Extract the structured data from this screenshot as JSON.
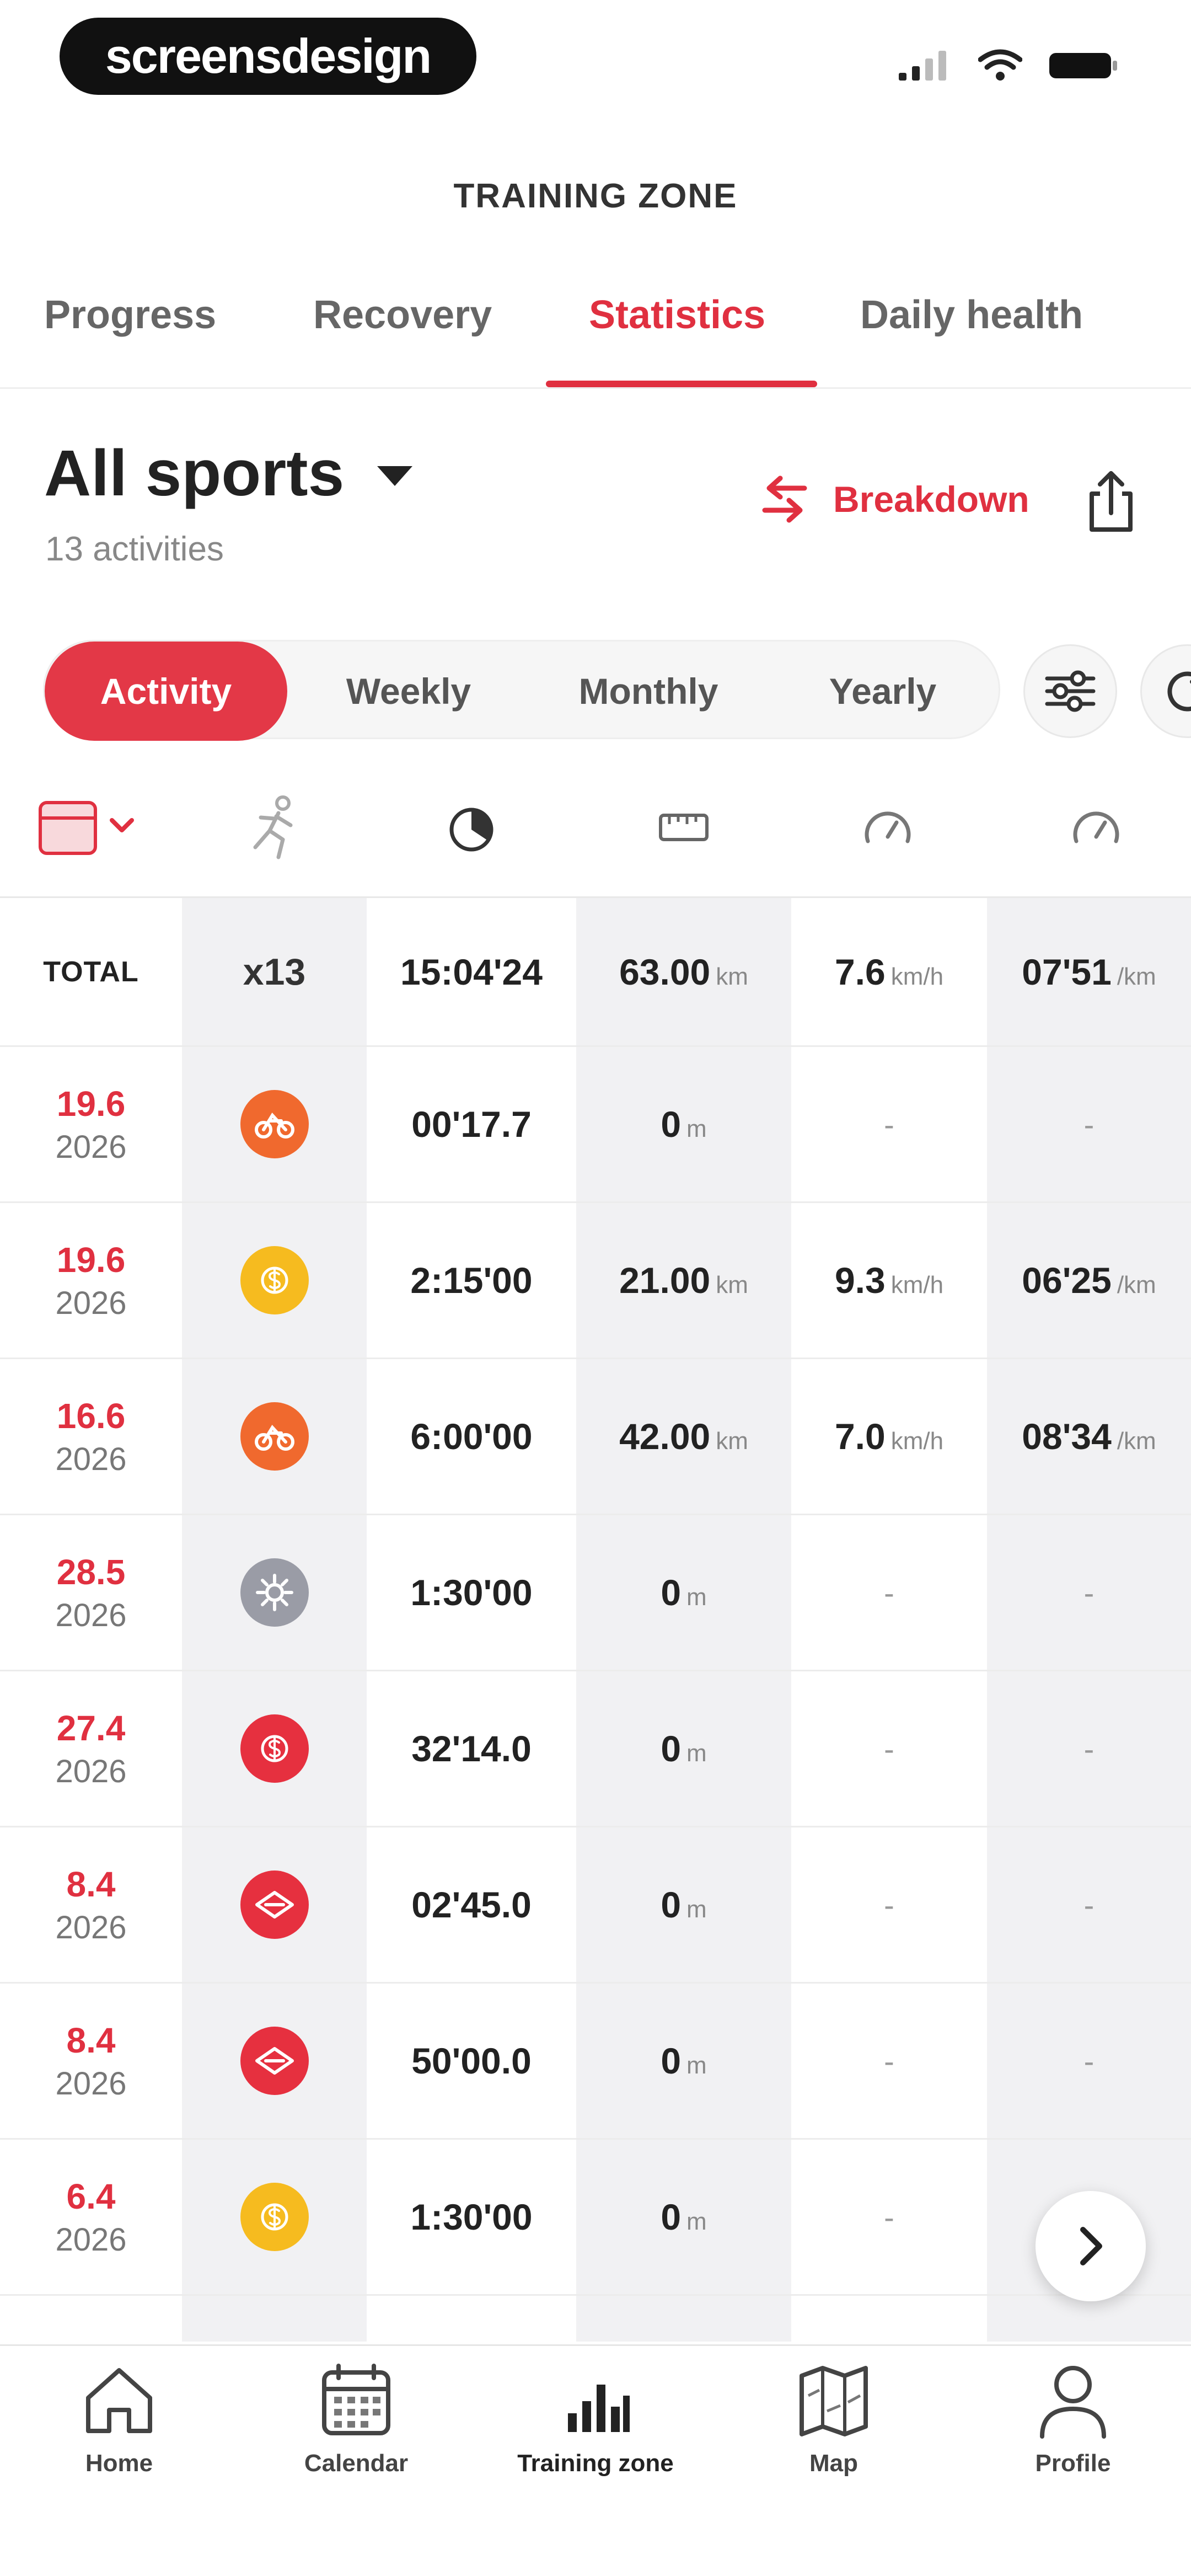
{
  "status_bar": {
    "brand": "screensdesign"
  },
  "header": {
    "title": "TRAINING ZONE"
  },
  "tabs": [
    {
      "label": "Progress"
    },
    {
      "label": "Recovery"
    },
    {
      "label": "Statistics"
    },
    {
      "label": "Daily health"
    }
  ],
  "summary": {
    "sport": "All sports",
    "activity_count": "13 activities",
    "breakdown_label": "Breakdown"
  },
  "periods": [
    {
      "label": "Activity"
    },
    {
      "label": "Weekly"
    },
    {
      "label": "Monthly"
    },
    {
      "label": "Yearly"
    }
  ],
  "columns": [
    "calendar-icon",
    "runner-icon",
    "stopwatch-icon",
    "ruler-icon",
    "speedometer-icon",
    "speedometer-icon"
  ],
  "totals": {
    "label": "TOTAL",
    "count": "x13",
    "duration": "15:04'24",
    "distance": "63.00",
    "distance_unit": "km",
    "speed": "7.6",
    "speed_unit": "km/h",
    "pace": "07'51",
    "pace_unit": "/km"
  },
  "rows": [
    {
      "day": "19.6",
      "year": "2026",
      "duration": "00'17.7",
      "distance": "0",
      "distance_unit": "m",
      "speed": "-",
      "speed_unit": "",
      "pace": "-",
      "pace_unit": ""
    },
    {
      "day": "19.6",
      "year": "2026",
      "duration": "2:15'00",
      "distance": "21.00",
      "distance_unit": "km",
      "speed": "9.3",
      "speed_unit": "km/h",
      "pace": "06'25",
      "pace_unit": "/km"
    },
    {
      "day": "16.6",
      "year": "2026",
      "duration": "6:00'00",
      "distance": "42.00",
      "distance_unit": "km",
      "speed": "7.0",
      "speed_unit": "km/h",
      "pace": "08'34",
      "pace_unit": "/km"
    },
    {
      "day": "28.5",
      "year": "2026",
      "duration": "1:30'00",
      "distance": "0",
      "distance_unit": "m",
      "speed": "-",
      "speed_unit": "",
      "pace": "-",
      "pace_unit": ""
    },
    {
      "day": "27.4",
      "year": "2026",
      "duration": "32'14.0",
      "distance": "0",
      "distance_unit": "m",
      "speed": "-",
      "speed_unit": "",
      "pace": "-",
      "pace_unit": ""
    },
    {
      "day": "8.4",
      "year": "2026",
      "duration": "02'45.0",
      "distance": "0",
      "distance_unit": "m",
      "speed": "-",
      "speed_unit": "",
      "pace": "-",
      "pace_unit": ""
    },
    {
      "day": "8.4",
      "year": "2026",
      "duration": "50'00.0",
      "distance": "0",
      "distance_unit": "m",
      "speed": "-",
      "speed_unit": "",
      "pace": "-",
      "pace_unit": ""
    },
    {
      "day": "6.4",
      "year": "2026",
      "duration": "1:30'00",
      "distance": "0",
      "distance_unit": "m",
      "speed": "-",
      "speed_unit": "",
      "pace": "-",
      "pace_unit": ""
    }
  ],
  "sport_icons": [
    {
      "icon": "bike-icon",
      "color": "#f0692e"
    },
    {
      "icon": "dollar-coin-icon",
      "color": "#f6bb1f"
    },
    {
      "icon": "bike-icon",
      "color": "#f0692e"
    },
    {
      "icon": "gear-icon",
      "color": "#9a9ca6"
    },
    {
      "icon": "dollar-coin-icon",
      "color": "#e6303f"
    },
    {
      "icon": "diamond-icon",
      "color": "#e6303f"
    },
    {
      "icon": "diamond-icon",
      "color": "#e6303f"
    },
    {
      "icon": "dollar-coin-icon",
      "color": "#f6bb1f"
    }
  ],
  "bottom_nav": [
    {
      "label": "Home",
      "icon": "home-icon"
    },
    {
      "label": "Calendar",
      "icon": "calendar-icon"
    },
    {
      "label": "Training zone",
      "icon": "bar-chart-icon"
    },
    {
      "label": "Map",
      "icon": "map-icon"
    },
    {
      "label": "Profile",
      "icon": "profile-icon"
    }
  ],
  "colors": {
    "accent": "#e03040",
    "shade": "#f1f1f3"
  }
}
